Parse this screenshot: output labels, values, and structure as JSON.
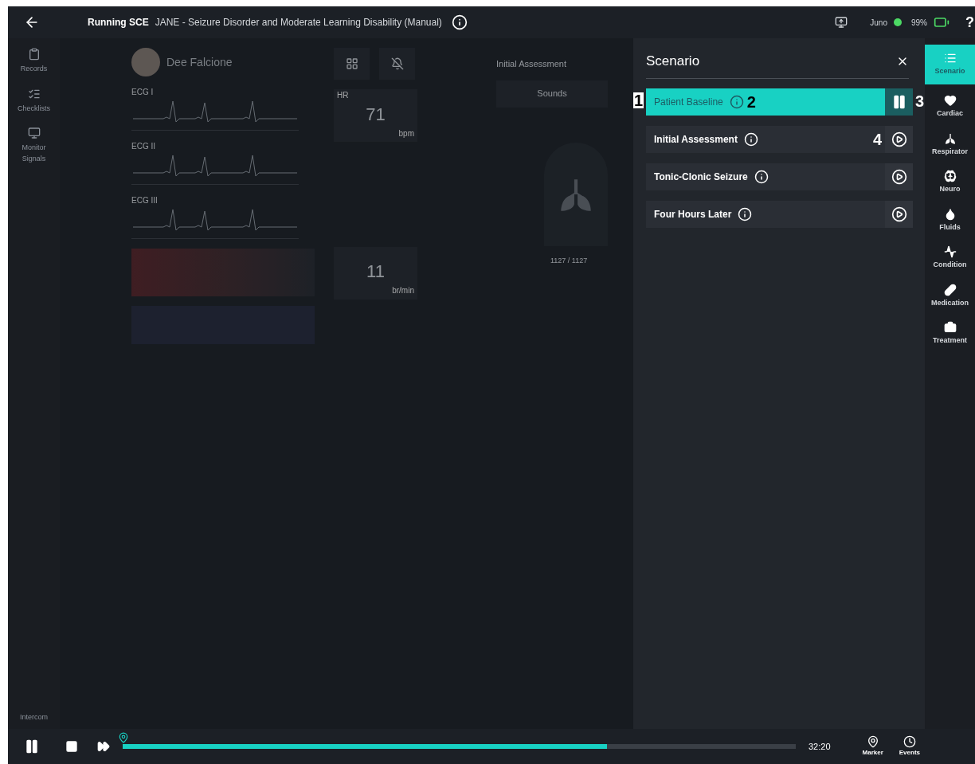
{
  "header": {
    "status": "Running SCE",
    "title": "JANE - Seizure Disorder and Moderate Learning Disability (Manual)",
    "device": "Juno",
    "battery": "99%",
    "help": "?"
  },
  "left_rail": [
    {
      "label": "Records",
      "kind": "clipboard"
    },
    {
      "label": "Checklists",
      "kind": "checklist"
    },
    {
      "label": "Monitor Signals",
      "kind": "monitor"
    }
  ],
  "intercom": "Intercom",
  "patient": {
    "name": "Dee Falcione"
  },
  "ecg": [
    {
      "label": "ECG I"
    },
    {
      "label": "ECG II"
    },
    {
      "label": "ECG III"
    }
  ],
  "vitals": [
    {
      "label": "HR",
      "value": "71",
      "unit": "bpm"
    },
    {
      "value": "11",
      "unit": "br/min"
    }
  ],
  "state_panel": {
    "current_state": "Initial Assessment",
    "sounds": "Sounds",
    "counter": "1127 / 1127"
  },
  "scenario": {
    "title": "Scenario",
    "items": [
      {
        "label": "Patient Baseline",
        "selected": true,
        "marks": [
          {
            "kind": "before-row",
            "text": "1"
          },
          {
            "kind": "after-info",
            "text": "2"
          },
          {
            "kind": "after-button",
            "text": "3"
          }
        ]
      },
      {
        "label": "Initial Assessment",
        "selected": false,
        "marks": [
          {
            "kind": "before-button",
            "text": "4"
          }
        ]
      },
      {
        "label": "Tonic-Clonic Seizure",
        "selected": false
      },
      {
        "label": "Four Hours Later",
        "selected": false
      }
    ]
  },
  "sidebar": [
    {
      "label": "Scenario",
      "kind": "list",
      "selected": true
    },
    {
      "label": "Cardiac",
      "kind": "heart",
      "selected": false
    },
    {
      "label": "Respirator",
      "kind": "lungs",
      "selected": false
    },
    {
      "label": "Neuro",
      "kind": "brain",
      "selected": false
    },
    {
      "label": "Fluids",
      "kind": "drop",
      "selected": false
    },
    {
      "label": "Condition",
      "kind": "pulse",
      "selected": false
    },
    {
      "label": "Medication",
      "kind": "pill",
      "selected": false
    },
    {
      "label": "Treatment",
      "kind": "kit",
      "selected": false
    }
  ],
  "playback": {
    "time": "32:20",
    "level": 0.72,
    "marker": "Marker",
    "events": "Events"
  }
}
